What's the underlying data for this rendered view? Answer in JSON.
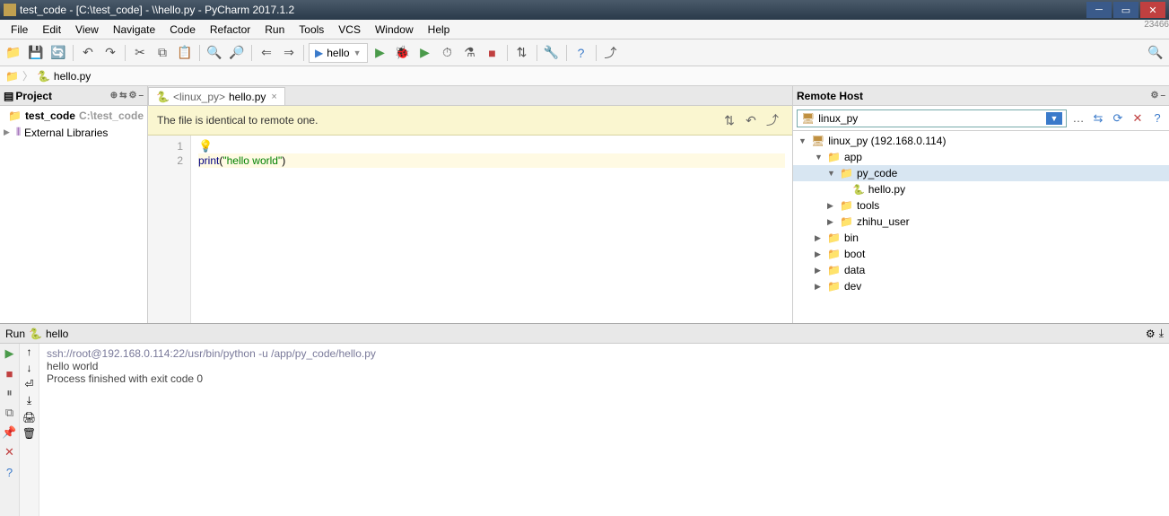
{
  "window": {
    "title": "test_code - [C:\\test_code] - \\\\hello.py - PyCharm 2017.1.2",
    "corner_text": "23466"
  },
  "menu": [
    "File",
    "Edit",
    "View",
    "Navigate",
    "Code",
    "Refactor",
    "Run",
    "Tools",
    "VCS",
    "Window",
    "Help"
  ],
  "toolbar": {
    "run_config": "hello"
  },
  "breadcrumb": {
    "file": "hello.py"
  },
  "project": {
    "header": "Project",
    "root": "test_code",
    "root_path": "C:\\test_code",
    "ext_libs": "External Libraries"
  },
  "editor": {
    "tab_prefix": "<linux_py>",
    "tab_file": "hello.py",
    "banner_msg": "The file is identical to remote one.",
    "lines": {
      "n1": "1",
      "n2": "2"
    },
    "code": {
      "print": "print",
      "open": "(",
      "str": "\"hello world\"",
      "close": ")"
    }
  },
  "remote": {
    "header": "Remote Host",
    "host_selected": "linux_py",
    "root": "linux_py (192.168.0.114)",
    "tree": {
      "app": "app",
      "py_code": "py_code",
      "hello": "hello.py",
      "tools": "tools",
      "zhihu_user": "zhihu_user",
      "bin": "bin",
      "boot": "boot",
      "data": "data",
      "dev": "dev"
    }
  },
  "run": {
    "header_prefix": "Run",
    "header_name": "hello",
    "cmd": "ssh://root@192.168.0.114:22/usr/bin/python -u /app/py_code/hello.py",
    "out1": "hello world",
    "out2": "",
    "exit": "Process finished with exit code 0"
  }
}
